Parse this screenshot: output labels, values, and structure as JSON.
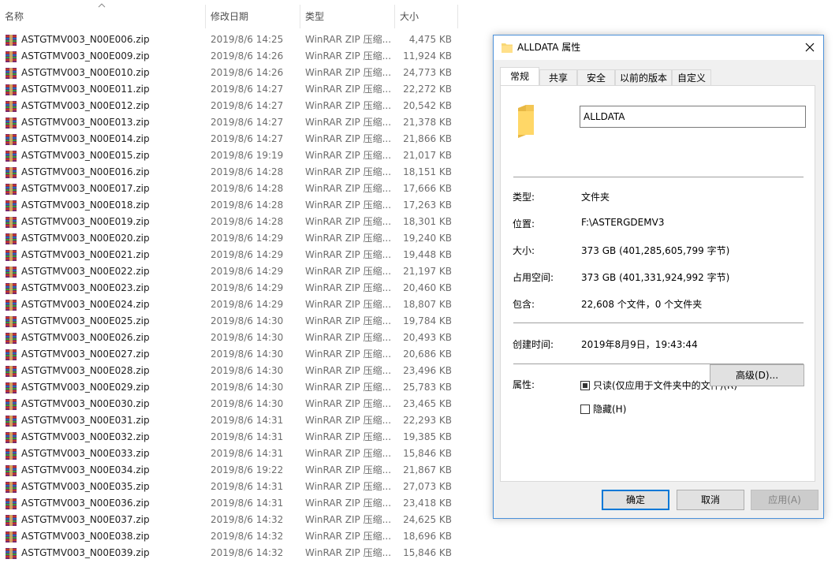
{
  "explorer": {
    "columns": {
      "name": "名称",
      "date": "修改日期",
      "type": "类型",
      "size": "大小"
    },
    "files": [
      {
        "name": "ASTGTMV003_N00E006.zip",
        "date": "2019/8/6 14:25",
        "type": "WinRAR ZIP 压缩...",
        "size": "4,475 KB"
      },
      {
        "name": "ASTGTMV003_N00E009.zip",
        "date": "2019/8/6 14:26",
        "type": "WinRAR ZIP 压缩...",
        "size": "11,924 KB"
      },
      {
        "name": "ASTGTMV003_N00E010.zip",
        "date": "2019/8/6 14:26",
        "type": "WinRAR ZIP 压缩...",
        "size": "24,773 KB"
      },
      {
        "name": "ASTGTMV003_N00E011.zip",
        "date": "2019/8/6 14:27",
        "type": "WinRAR ZIP 压缩...",
        "size": "22,272 KB"
      },
      {
        "name": "ASTGTMV003_N00E012.zip",
        "date": "2019/8/6 14:27",
        "type": "WinRAR ZIP 压缩...",
        "size": "20,542 KB"
      },
      {
        "name": "ASTGTMV003_N00E013.zip",
        "date": "2019/8/6 14:27",
        "type": "WinRAR ZIP 压缩...",
        "size": "21,378 KB"
      },
      {
        "name": "ASTGTMV003_N00E014.zip",
        "date": "2019/8/6 14:27",
        "type": "WinRAR ZIP 压缩...",
        "size": "21,866 KB"
      },
      {
        "name": "ASTGTMV003_N00E015.zip",
        "date": "2019/8/6 19:19",
        "type": "WinRAR ZIP 压缩...",
        "size": "21,017 KB"
      },
      {
        "name": "ASTGTMV003_N00E016.zip",
        "date": "2019/8/6 14:28",
        "type": "WinRAR ZIP 压缩...",
        "size": "18,151 KB"
      },
      {
        "name": "ASTGTMV003_N00E017.zip",
        "date": "2019/8/6 14:28",
        "type": "WinRAR ZIP 压缩...",
        "size": "17,666 KB"
      },
      {
        "name": "ASTGTMV003_N00E018.zip",
        "date": "2019/8/6 14:28",
        "type": "WinRAR ZIP 压缩...",
        "size": "17,263 KB"
      },
      {
        "name": "ASTGTMV003_N00E019.zip",
        "date": "2019/8/6 14:28",
        "type": "WinRAR ZIP 压缩...",
        "size": "18,301 KB"
      },
      {
        "name": "ASTGTMV003_N00E020.zip",
        "date": "2019/8/6 14:29",
        "type": "WinRAR ZIP 压缩...",
        "size": "19,240 KB"
      },
      {
        "name": "ASTGTMV003_N00E021.zip",
        "date": "2019/8/6 14:29",
        "type": "WinRAR ZIP 压缩...",
        "size": "19,448 KB"
      },
      {
        "name": "ASTGTMV003_N00E022.zip",
        "date": "2019/8/6 14:29",
        "type": "WinRAR ZIP 压缩...",
        "size": "21,197 KB"
      },
      {
        "name": "ASTGTMV003_N00E023.zip",
        "date": "2019/8/6 14:29",
        "type": "WinRAR ZIP 压缩...",
        "size": "20,460 KB"
      },
      {
        "name": "ASTGTMV003_N00E024.zip",
        "date": "2019/8/6 14:29",
        "type": "WinRAR ZIP 压缩...",
        "size": "18,807 KB"
      },
      {
        "name": "ASTGTMV003_N00E025.zip",
        "date": "2019/8/6 14:30",
        "type": "WinRAR ZIP 压缩...",
        "size": "19,784 KB"
      },
      {
        "name": "ASTGTMV003_N00E026.zip",
        "date": "2019/8/6 14:30",
        "type": "WinRAR ZIP 压缩...",
        "size": "20,493 KB"
      },
      {
        "name": "ASTGTMV003_N00E027.zip",
        "date": "2019/8/6 14:30",
        "type": "WinRAR ZIP 压缩...",
        "size": "20,686 KB"
      },
      {
        "name": "ASTGTMV003_N00E028.zip",
        "date": "2019/8/6 14:30",
        "type": "WinRAR ZIP 压缩...",
        "size": "23,496 KB"
      },
      {
        "name": "ASTGTMV003_N00E029.zip",
        "date": "2019/8/6 14:30",
        "type": "WinRAR ZIP 压缩...",
        "size": "25,783 KB"
      },
      {
        "name": "ASTGTMV003_N00E030.zip",
        "date": "2019/8/6 14:30",
        "type": "WinRAR ZIP 压缩...",
        "size": "23,465 KB"
      },
      {
        "name": "ASTGTMV003_N00E031.zip",
        "date": "2019/8/6 14:31",
        "type": "WinRAR ZIP 压缩...",
        "size": "22,293 KB"
      },
      {
        "name": "ASTGTMV003_N00E032.zip",
        "date": "2019/8/6 14:31",
        "type": "WinRAR ZIP 压缩...",
        "size": "19,385 KB"
      },
      {
        "name": "ASTGTMV003_N00E033.zip",
        "date": "2019/8/6 14:31",
        "type": "WinRAR ZIP 压缩...",
        "size": "15,846 KB"
      },
      {
        "name": "ASTGTMV003_N00E034.zip",
        "date": "2019/8/6 19:22",
        "type": "WinRAR ZIP 压缩...",
        "size": "21,867 KB"
      },
      {
        "name": "ASTGTMV003_N00E035.zip",
        "date": "2019/8/6 14:31",
        "type": "WinRAR ZIP 压缩...",
        "size": "27,073 KB"
      },
      {
        "name": "ASTGTMV003_N00E036.zip",
        "date": "2019/8/6 14:31",
        "type": "WinRAR ZIP 压缩...",
        "size": "23,418 KB"
      },
      {
        "name": "ASTGTMV003_N00E037.zip",
        "date": "2019/8/6 14:32",
        "type": "WinRAR ZIP 压缩...",
        "size": "24,625 KB"
      },
      {
        "name": "ASTGTMV003_N00E038.zip",
        "date": "2019/8/6 14:32",
        "type": "WinRAR ZIP 压缩...",
        "size": "18,696 KB"
      },
      {
        "name": "ASTGTMV003_N00E039.zip",
        "date": "2019/8/6 14:32",
        "type": "WinRAR ZIP 压缩...",
        "size": "15,846 KB"
      }
    ]
  },
  "dialog": {
    "title": "ALLDATA 属性",
    "tabs": [
      "常规",
      "共享",
      "安全",
      "以前的版本",
      "自定义"
    ],
    "active_tab": "常规",
    "folder_name": "ALLDATA",
    "props": {
      "type_label": "类型:",
      "type_value": "文件夹",
      "location_label": "位置:",
      "location_value": "F:\\ASTERGDEMV3",
      "size_label": "大小:",
      "size_value": "373 GB (401,285,605,799 字节)",
      "disk_label": "占用空间:",
      "disk_value": "373 GB (401,331,924,992 字节)",
      "contains_label": "包含:",
      "contains_value": "22,608 个文件，0 个文件夹",
      "created_label": "创建时间:",
      "created_value": "2019年8月9日，19:43:44",
      "attr_label": "属性:",
      "readonly_label": "只读(仅应用于文件夹中的文件)(R)",
      "readonly_checked": true,
      "hidden_label": "隐藏(H)",
      "hidden_checked": false,
      "advanced_label": "高级(D)..."
    },
    "buttons": {
      "ok": "确定",
      "cancel": "取消",
      "apply": "应用(A)"
    }
  },
  "colors": {
    "accent": "#0078d7",
    "folder": "#f8d775",
    "dialog_border": "#4a90d9"
  },
  "icons": {
    "file": "winrar-zip-icon",
    "folder": "folder-icon",
    "close": "close-icon",
    "sort": "sort-up-icon"
  }
}
